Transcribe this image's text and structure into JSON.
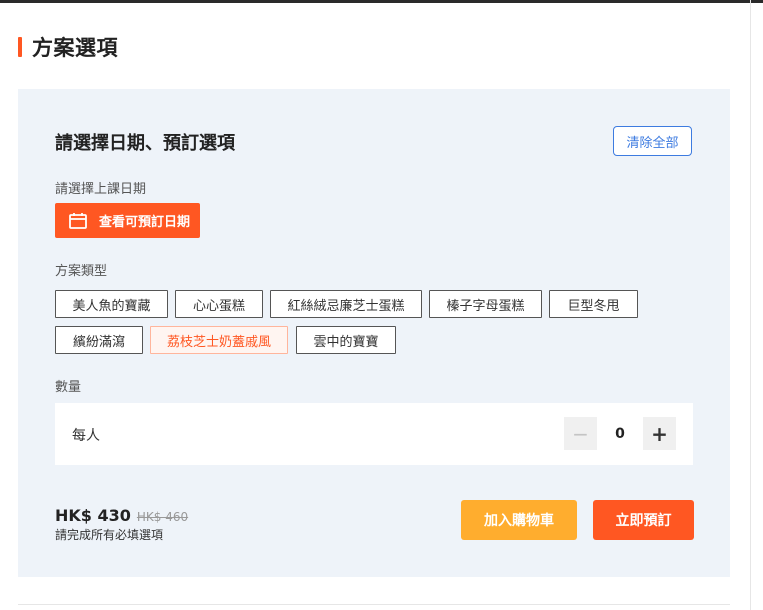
{
  "section": {
    "title": "方案選項"
  },
  "panel": {
    "heading": "請選擇日期、預訂選項",
    "clear_label": "清除全部"
  },
  "date": {
    "label": "請選擇上課日期",
    "button_label": "查看可預訂日期",
    "button_icon": "calendar-icon"
  },
  "package": {
    "label": "方案類型",
    "options": [
      {
        "label": "美人魚的寶藏",
        "selected": false
      },
      {
        "label": "心心蛋糕",
        "selected": false
      },
      {
        "label": "紅絲絨忌廉芝士蛋糕",
        "selected": false
      },
      {
        "label": "榛子字母蛋糕",
        "selected": false
      },
      {
        "label": "巨型冬甩",
        "selected": false
      },
      {
        "label": "繽紛滿瀉",
        "selected": false
      },
      {
        "label": "荔枝芝士奶蓋戚風",
        "selected": true
      },
      {
        "label": "雲中的寶寶",
        "selected": false
      }
    ]
  },
  "quantity": {
    "label": "數量",
    "row_label": "每人",
    "value": "0",
    "minus": "−",
    "plus": "+"
  },
  "summary": {
    "price": "HK$ 430",
    "original_price": "HK$ 460",
    "note": "請完成所有必填選項"
  },
  "actions": {
    "add_to_cart": "加入購物車",
    "book_now": "立即預訂"
  },
  "colors": {
    "accent": "#ff5722",
    "cart": "#ffad2e",
    "link_blue": "#3d7be0",
    "panel_bg": "#eef3f9"
  }
}
